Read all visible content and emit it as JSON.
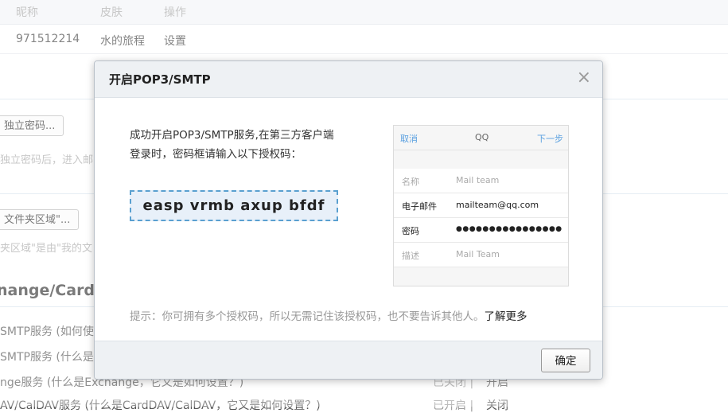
{
  "table": {
    "headers": [
      "昵称",
      "皮肤",
      "操作"
    ],
    "row": {
      "id": "971512214",
      "skin": "水的旅程",
      "action": "设置"
    }
  },
  "background": {
    "password_button": "独立密码...",
    "password_hint": "独立密码后，进入邮",
    "folder_button": "文件夹区域\"...",
    "folder_hint": "夹区域\"是由\"我的文",
    "section_heading": "nange/CardD",
    "service_lines": [
      "SMTP服务 (如何使",
      "SMTP服务 (什么是",
      "nge服务 (什么是Exchange，它又是如何设置？)",
      "AV/CalDAV服务 (什么是CardDAV/CalDAV，它又是如何设置？)"
    ],
    "status_3": "已关闭 |",
    "action_3": "开启",
    "status_4": "已开启 |",
    "action_4": "关闭"
  },
  "dialog": {
    "title": "开启POP3/SMTP",
    "close": "×",
    "message_line1": "成功开启POP3/SMTP服务,在第三方客户端",
    "message_line2": "登录时，密码框请输入以下授权码：",
    "auth_code": "easp vrmb axup bfdf",
    "phone": {
      "cancel": "取消",
      "title": "QQ",
      "next": "下一步",
      "rows": [
        {
          "key": "名称",
          "value": "Mail team"
        },
        {
          "key": "电子邮件",
          "value": "mailteam@qq.com"
        },
        {
          "key": "密码",
          "value": "●●●●●●●●●●●●●●●●"
        },
        {
          "key": "描述",
          "value": "Mail Team"
        }
      ]
    },
    "tip": "提示：你可拥有多个授权码，所以无需记住该授权码，也不要告诉其他人。",
    "learn_more": "了解更多",
    "ok_button": "确定"
  }
}
